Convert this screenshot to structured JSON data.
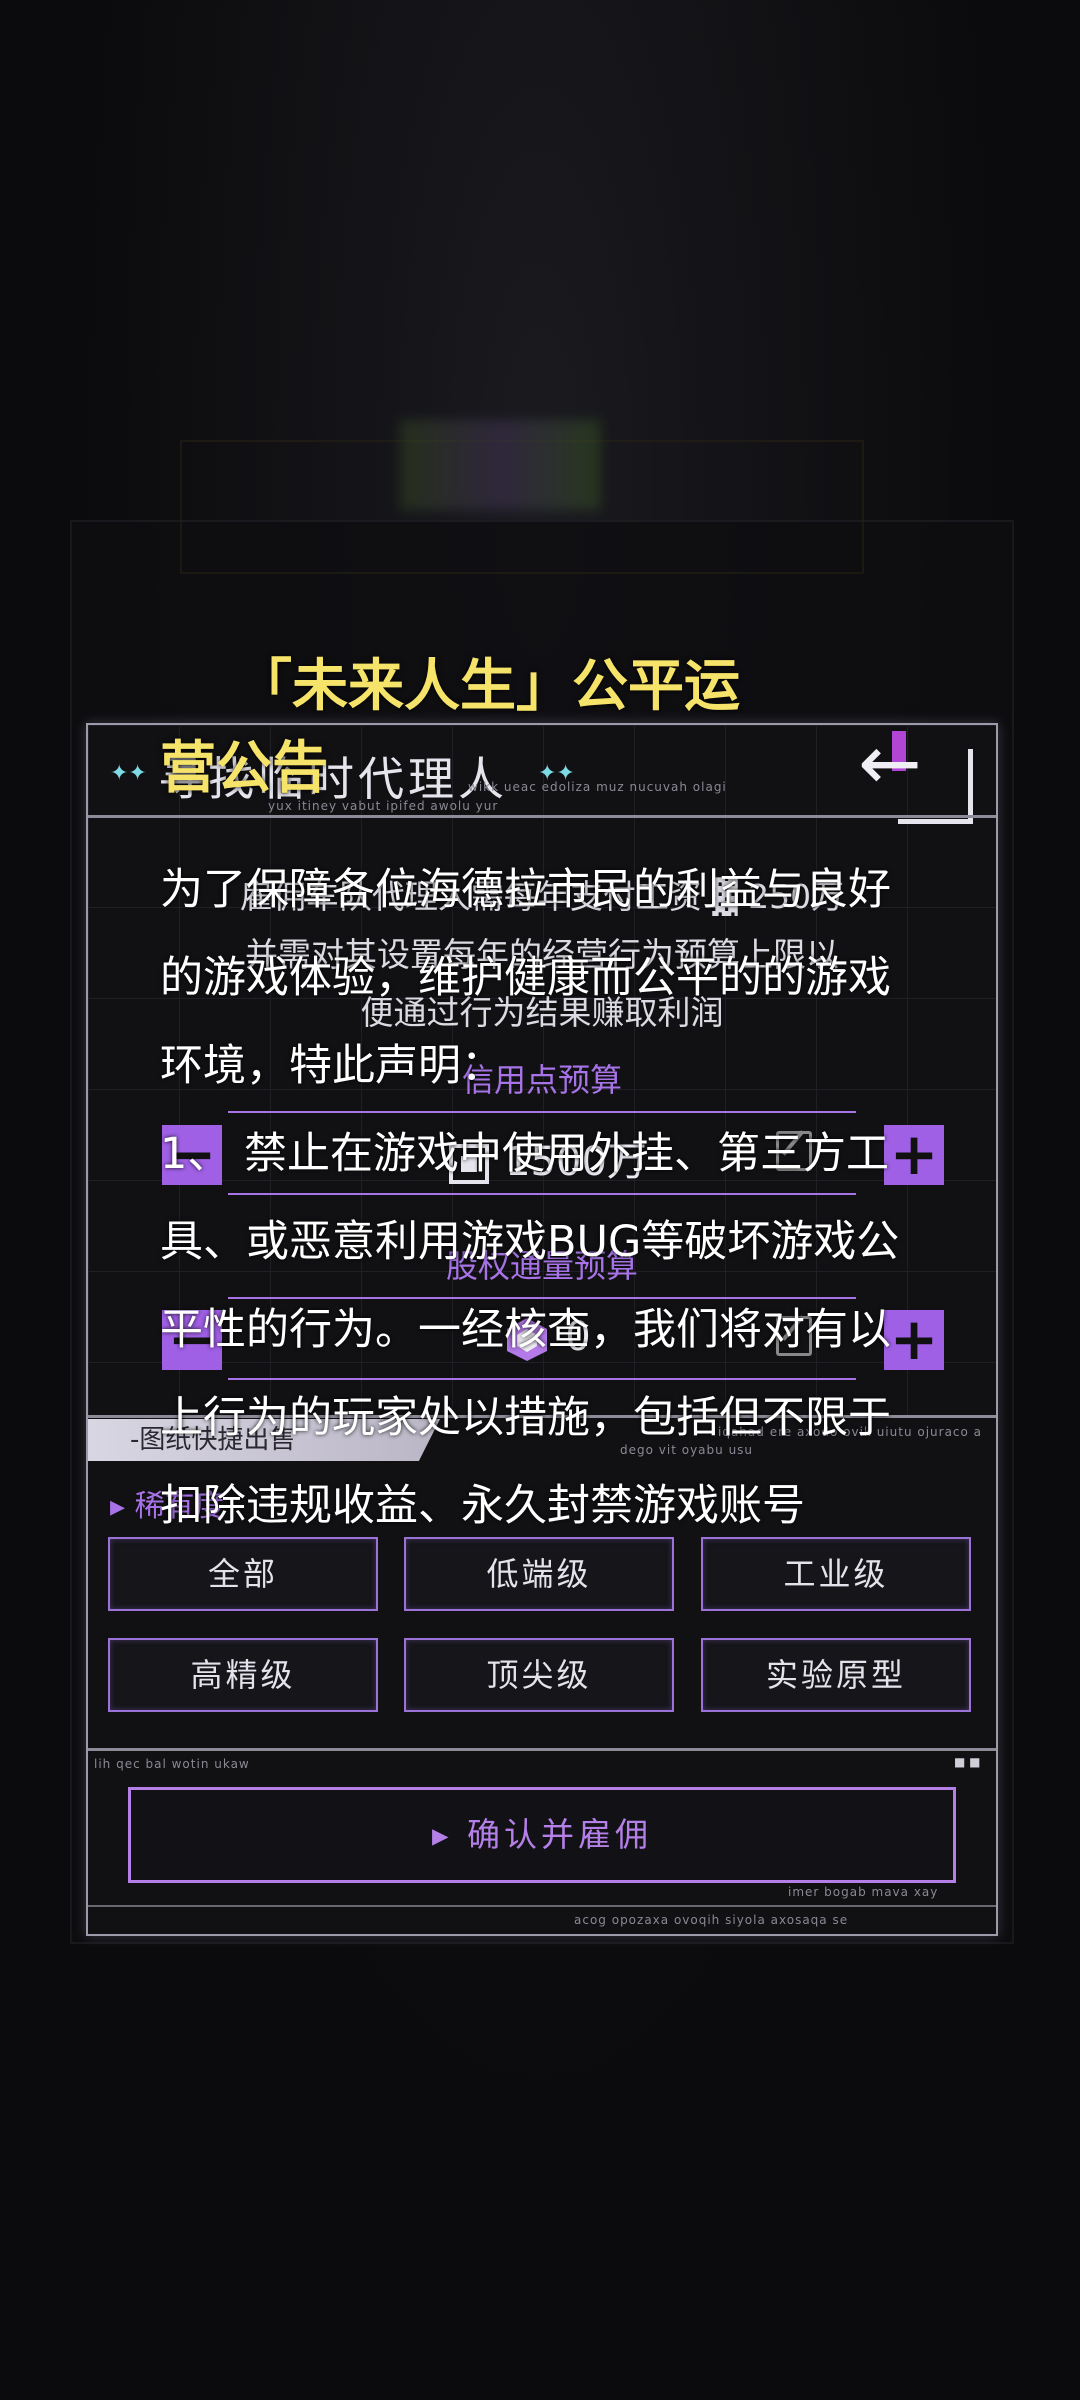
{
  "dialog": {
    "title": "寻找临时代理人",
    "subtitle_noise": "wikk ueac edoliza muz nucuvah olagi",
    "subtitle_noise2": "yux itiney vabut ipifed awolu yur",
    "info_lines": [
      "雇佣车队代理人需每年支付工资 ▓ 250万",
      "并需对其设置每年的经营行为预算上限以",
      "便通过行为结果赚取利润"
    ],
    "credit_budget": {
      "label": "信用点预算",
      "value": "1500万"
    },
    "equity_budget": {
      "label": "股权通量预算",
      "value": "0"
    },
    "quick_sale_tab": "-图纸快捷出售",
    "noise_right": "iqahad ere axodo ovik uiutu ojuraco a",
    "noise_right2": "dego vit oyabu usu",
    "rarity_title": "稀有度",
    "grades": [
      "全部",
      "低端级",
      "工业级",
      "高精级",
      "顶尖级",
      "实验原型"
    ],
    "noise_bottom": "lih qec bal wotin ukaw",
    "confirm_label": "确认并雇佣",
    "noise_confirm": "imer bogab mava xay",
    "noise_footer": "acog opozaxa ovoqih siyola axosaqa se"
  },
  "notice": {
    "title_line1": "「未来人生」公平运",
    "title_line2": "营公告",
    "paragraphs": [
      "为了保障各位海德拉市民的利益与良好的游戏体验，维护健康而公平的的游戏环境，特此声明：",
      "1、 禁止在游戏中使用外挂、第三方工具、或恶意利用游戏BUG等破坏游戏公平性的行为。一经核查，我们将对有以上行为的玩家处以措施，包括但不限于扣除违规收益、永久封禁游戏账号"
    ]
  },
  "colors": {
    "accent_purple": "#a773e6",
    "notice_yellow": "#f6e46a",
    "panel_border": "#9f9aaa"
  },
  "icons": {
    "back": "arrow-left-icon",
    "credit": "credit-chip-icon",
    "equity": "equity-cube-icon",
    "edit": "edit-icon",
    "minus": "minus-icon",
    "plus": "plus-icon"
  }
}
